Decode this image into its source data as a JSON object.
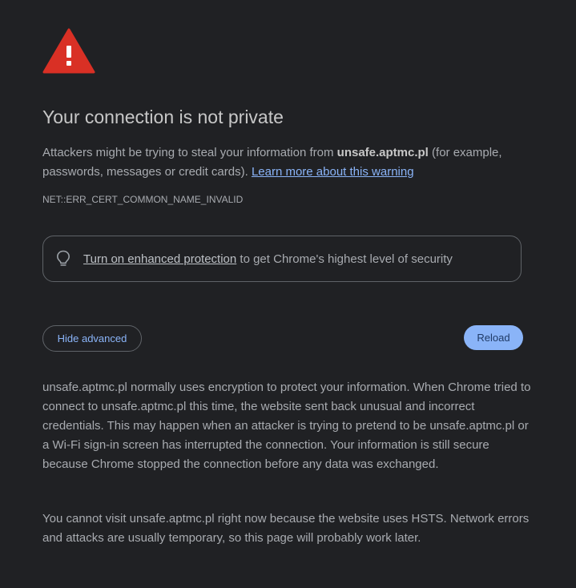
{
  "interstitial": {
    "title": "Your connection is not private",
    "intro_before": "Attackers might be trying to steal your information from ",
    "domain": "unsafe.aptmc.pl",
    "intro_after": " (for example, passwords, messages or credit cards). ",
    "learn_more_link": "Learn more about this warning",
    "error_code": "NET::ERR_CERT_COMMON_NAME_INVALID",
    "protection_link": "Turn on enhanced protection",
    "protection_rest": " to get Chrome's highest level of security",
    "hide_advanced_button": "Hide advanced",
    "reload_button": "Reload",
    "details_text": "unsafe.aptmc.pl normally uses encryption to protect your information. When Chrome tried to connect to unsafe.aptmc.pl this time, the website sent back unusual and incorrect credentials. This may happen when an attacker is trying to pretend to be unsafe.aptmc.pl or a Wi-Fi sign-in screen has interrupted the connection. Your information is still secure because Chrome stopped the connection before any data was exchanged.",
    "hsts_text": "You cannot visit unsafe.aptmc.pl right now because the website uses HSTS. Network errors and attacks are usually temporary, so this page will probably work later."
  },
  "icons": {
    "warning": "warning-triangle-icon",
    "bulb": "lightbulb-icon"
  },
  "colors": {
    "background": "#202124",
    "warning_red": "#d93025",
    "link_blue": "#8ab4f8",
    "reload_bg": "#8ab4f8"
  }
}
